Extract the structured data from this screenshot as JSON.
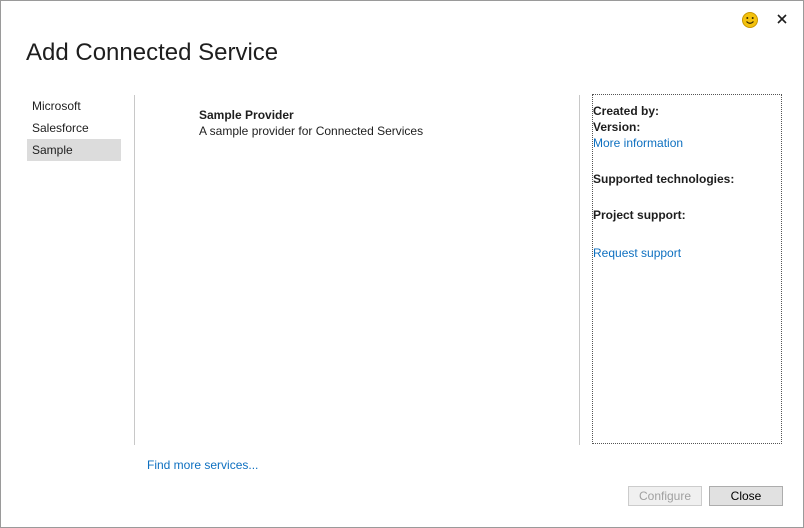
{
  "dialog": {
    "title": "Add Connected Service"
  },
  "titlebar": {
    "feedback_icon": "smiley-icon",
    "close_icon": "close-icon"
  },
  "categories": {
    "items": [
      {
        "label": "Microsoft",
        "selected": false
      },
      {
        "label": "Salesforce",
        "selected": false
      },
      {
        "label": "Sample",
        "selected": true
      }
    ]
  },
  "providers": [
    {
      "name": "Sample Provider",
      "description": "A sample provider for Connected Services"
    }
  ],
  "details": {
    "created_by_label": "Created by:",
    "version_label": "Version:",
    "more_info_link": "More information",
    "supported_tech_label": "Supported technologies:",
    "project_support_label": "Project support:",
    "request_support_link": "Request support"
  },
  "footer": {
    "find_more_link": "Find more services...",
    "configure_label": "Configure",
    "configure_enabled": false,
    "close_label": "Close"
  },
  "colors": {
    "link": "#0e70c0",
    "selected_bg": "#dcdcdc",
    "smiley_face": "#f4c20d"
  }
}
